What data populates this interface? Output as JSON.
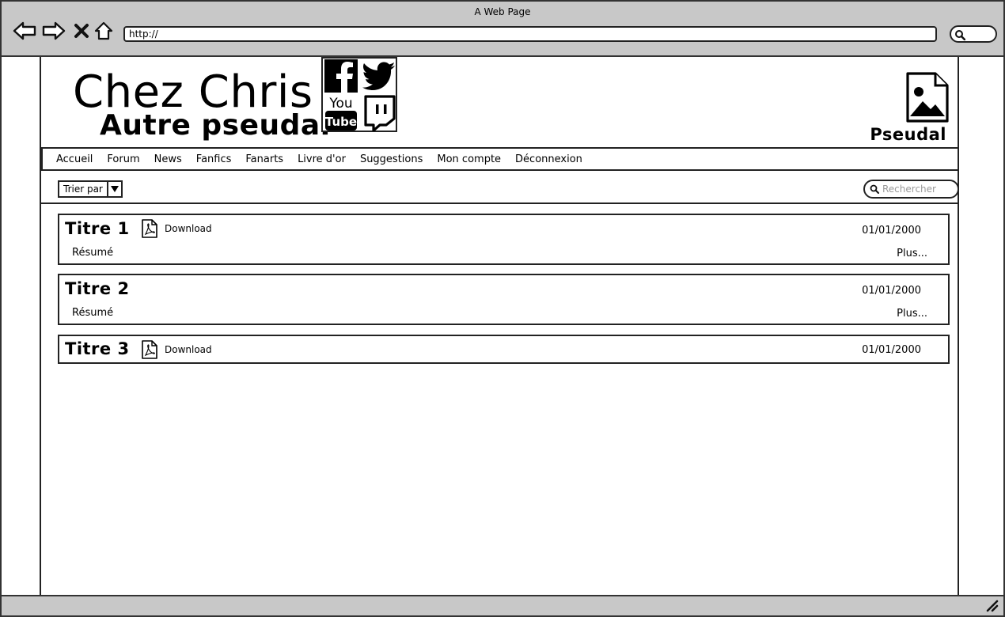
{
  "browser": {
    "window_title": "A Web Page",
    "url": "http://"
  },
  "site": {
    "title": "Chez Chris",
    "subtitle": "Autre pseudal",
    "social_icons": [
      "facebook-icon",
      "twitter-icon",
      "youtube-icon",
      "twitch-icon"
    ],
    "youtube_you": "You",
    "youtube_tube": "Tube",
    "profile_name": "Pseudal"
  },
  "nav": {
    "items": [
      "Accueil",
      "Forum",
      "News",
      "Fanfics",
      "Fanarts",
      "Livre d'or",
      "Suggestions",
      "Mon compte",
      "Déconnexion"
    ]
  },
  "toolbar": {
    "sort_label": "Trier par",
    "search_placeholder": "Rechercher"
  },
  "items": [
    {
      "title": "Titre 1",
      "download": "Download",
      "date": "01/01/2000",
      "summary": "Résumé",
      "more": "Plus..."
    },
    {
      "title": "Titre 2",
      "date": "01/01/2000",
      "summary": "Résumé",
      "more": "Plus..."
    },
    {
      "title": "Titre 3",
      "download": "Download",
      "date": "01/01/2000"
    }
  ]
}
